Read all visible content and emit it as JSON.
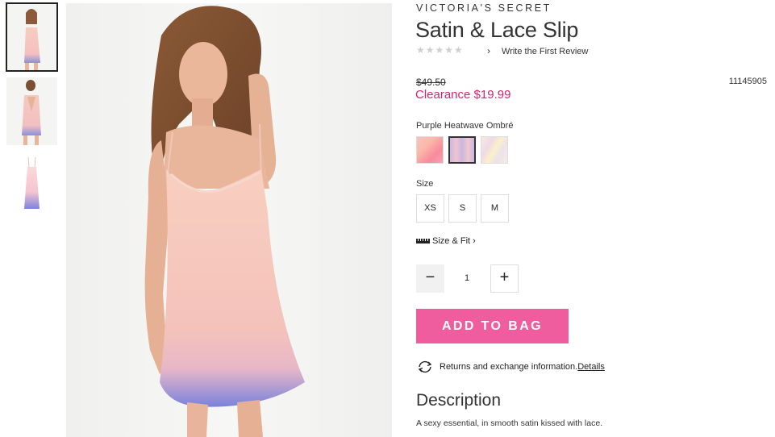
{
  "gallery": {
    "thumbnails": [
      "front-view",
      "back-view",
      "flat-lay-view"
    ],
    "selected_index": 0
  },
  "product": {
    "brand": "VICTORIA'S SECRET",
    "title": "Satin & Lace Slip",
    "rating": {
      "stars": "★★★★★",
      "filled": 0,
      "review_link": "Write the First Review"
    },
    "price": {
      "original": "$49.50",
      "sale": "Clearance $19.99"
    },
    "sku": "11145905",
    "color": {
      "selected_name": "Purple Heatwave Ombré",
      "swatch_count": 3,
      "selected_index": 1
    },
    "size": {
      "label": "Size",
      "options": [
        "XS",
        "S",
        "M"
      ]
    },
    "fit": {
      "label": "Size & Fit",
      "chevron": "›"
    },
    "quantity": {
      "minus": "−",
      "value": "1",
      "plus": "+"
    },
    "add_to_bag": "ADD TO BAG",
    "returns": {
      "text": "Returns and exchange information.",
      "link": "Details"
    },
    "description": {
      "heading": "Description",
      "text": "A sexy essential, in smooth satin kissed with lace."
    }
  },
  "colors": {
    "accent_pink": "#ef5d9e",
    "sale_red": "#d6246e",
    "border": "#dddddd"
  }
}
